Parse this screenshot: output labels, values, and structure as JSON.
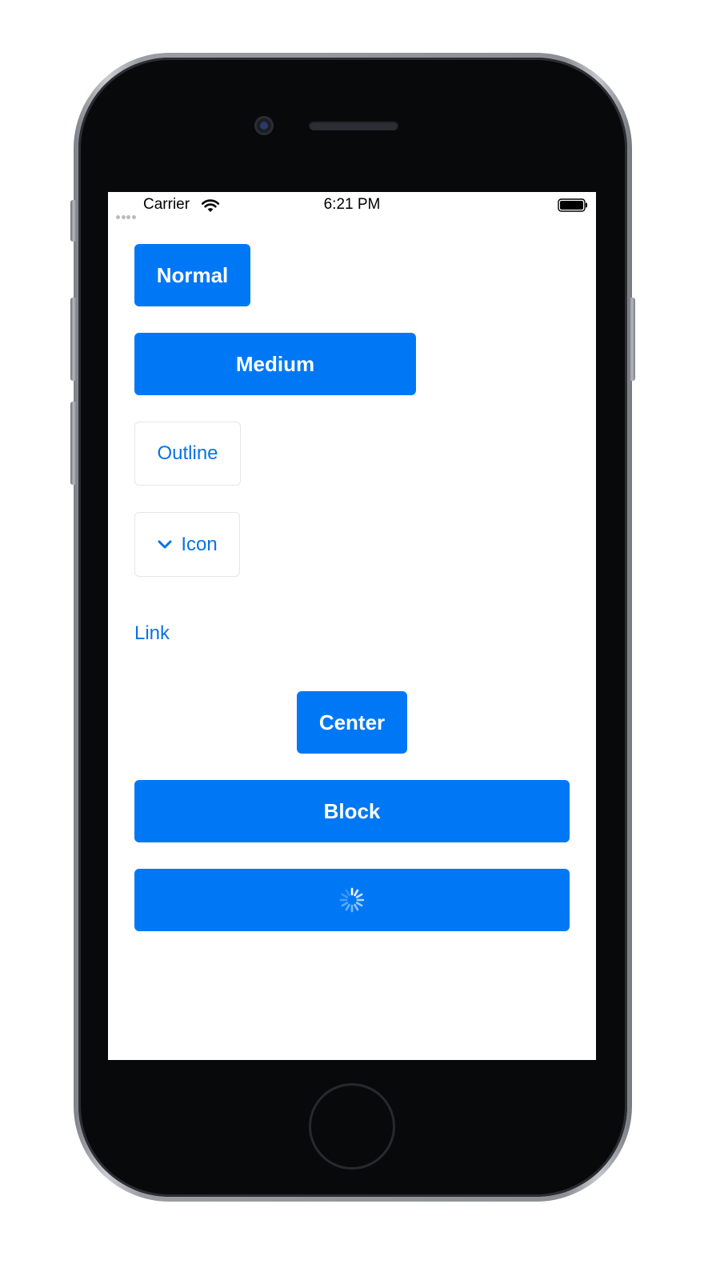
{
  "status_bar": {
    "carrier": "Carrier",
    "time": "6:21 PM",
    "icons": [
      "signal-dots-icon",
      "wifi-icon",
      "battery-icon"
    ]
  },
  "buttons": {
    "normal": "Normal",
    "medium": "Medium",
    "outline": "Outline",
    "icon_label": "Icon",
    "icon_name": "chevron-down-icon",
    "link": "Link",
    "center": "Center",
    "block": "Block",
    "loading_icon": "spinner-icon"
  },
  "colors": {
    "primary": "#0078f6",
    "link": "#0a72e6",
    "outline_border": "#e4e6ea",
    "phone_body": "#08090b"
  }
}
